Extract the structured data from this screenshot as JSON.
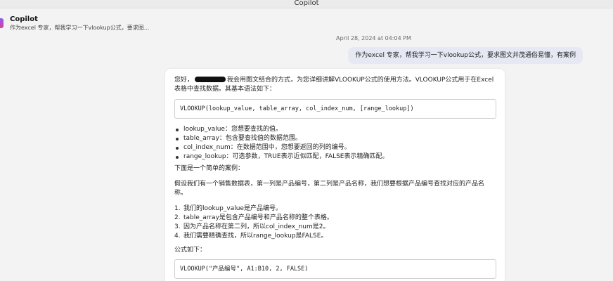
{
  "window": {
    "title": "Copilot"
  },
  "conversation": {
    "title": "Copilot",
    "preview": "作为excel 专家，帮我学习一下vlookup公式，要求图..."
  },
  "chat": {
    "timestamp": "April 28, 2024 at 04:04 PM",
    "user_message": "作为excel 专家，帮我学习一下vlookup公式，要求图文并茂通俗易懂，有案例"
  },
  "answer": {
    "greeting": "您好，",
    "intro": "我会用图文结合的方式，为您详细讲解VLOOKUP公式的使用方法。VLOOKUP公式用于在Excel表格中查找数据。其基本语法如下：",
    "syntax": "VLOOKUP(lookup_value, table_array, col_index_num, [range_lookup])",
    "params": [
      {
        "name": "lookup_value",
        "desc": "：您想要查找的值。"
      },
      {
        "name": "table_array",
        "desc": "：包含要查找值的数据范围。"
      },
      {
        "name": "col_index_num",
        "desc": "：在数据范围中，您想要返回的列的编号。"
      },
      {
        "name": "range_lookup",
        "desc": "：可选参数，TRUE表示近似匹配，FALSE表示精确匹配。"
      }
    ],
    "example_heading": "下面是一个简单的案例：",
    "example_desc": "假设我们有一个销售数据表，第一列是产品编号，第二列是产品名称，我们想要根据产品编号查找对应的产品名称。",
    "steps": [
      {
        "num": "1.",
        "text": "我们的lookup_value是产品编号。"
      },
      {
        "num": "2.",
        "text": "table_array是包含产品编号和产品名称的整个表格。"
      },
      {
        "num": "3.",
        "text": "因为产品名称在第二列，所以col_index_num是2。"
      },
      {
        "num": "4.",
        "text": "我们需要精确查找，所以range_lookup是FALSE。"
      }
    ],
    "formula_heading": "公式如下：",
    "formula": "VLOOKUP(\"产品编号\", A1:B10, 2, FALSE)"
  },
  "colors": {
    "background": "#f3f3f3",
    "user_bubble": "#e6e8f4",
    "card": "#ffffff"
  }
}
